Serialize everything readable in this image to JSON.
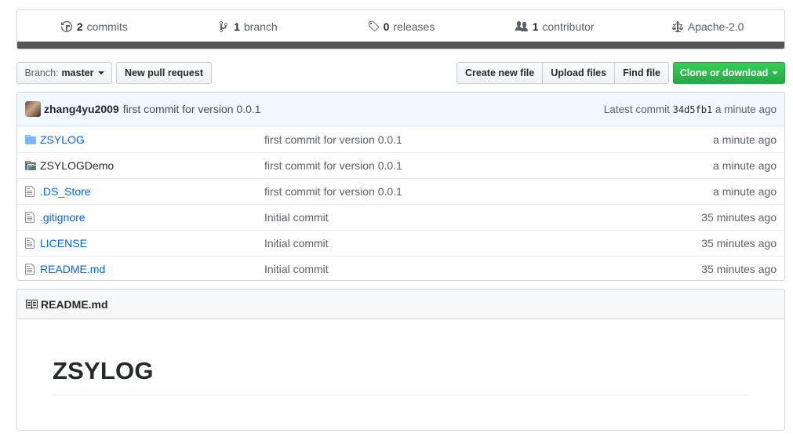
{
  "summary": {
    "commits": {
      "count": "2",
      "label": "commits",
      "icon": "history-icon"
    },
    "branch": {
      "count": "1",
      "label": "branch",
      "icon": "branch-icon"
    },
    "releases": {
      "count": "0",
      "label": "releases",
      "icon": "tag-icon"
    },
    "contributors": {
      "count": "1",
      "label": "contributor",
      "icon": "people-icon"
    },
    "license": {
      "label": "Apache-2.0",
      "icon": "law-icon"
    },
    "language_bar_color": "#555555"
  },
  "toolbar": {
    "branch_prefix": "Branch:",
    "branch_name": "master",
    "new_pull_request": "New pull request",
    "create_new_file": "Create new file",
    "upload_files": "Upload files",
    "find_file": "Find file",
    "clone_or_download": "Clone or download",
    "clone_color": "#28a745"
  },
  "latest_commit": {
    "author": "zhang4yu2009",
    "message": "first commit for version 0.0.1",
    "prefix": "Latest commit",
    "sha": "34d5fb1",
    "age": "a minute ago"
  },
  "files": [
    {
      "name": "ZSYLOG",
      "type": "folder",
      "message": "first commit for version 0.0.1",
      "age": "a minute ago"
    },
    {
      "name": "ZSYLOGDemo",
      "type": "submodule",
      "message": "first commit for version 0.0.1",
      "age": "a minute ago"
    },
    {
      "name": ".DS_Store",
      "type": "file",
      "message": "first commit for version 0.0.1",
      "age": "a minute ago"
    },
    {
      "name": ".gitignore",
      "type": "file",
      "message": "Initial commit",
      "age": "35 minutes ago"
    },
    {
      "name": "LICENSE",
      "type": "file",
      "message": "Initial commit",
      "age": "35 minutes ago"
    },
    {
      "name": "README.md",
      "type": "file",
      "message": "Initial commit",
      "age": "35 minutes ago"
    }
  ],
  "readme": {
    "filename": "README.md",
    "heading": "ZSYLOG"
  }
}
